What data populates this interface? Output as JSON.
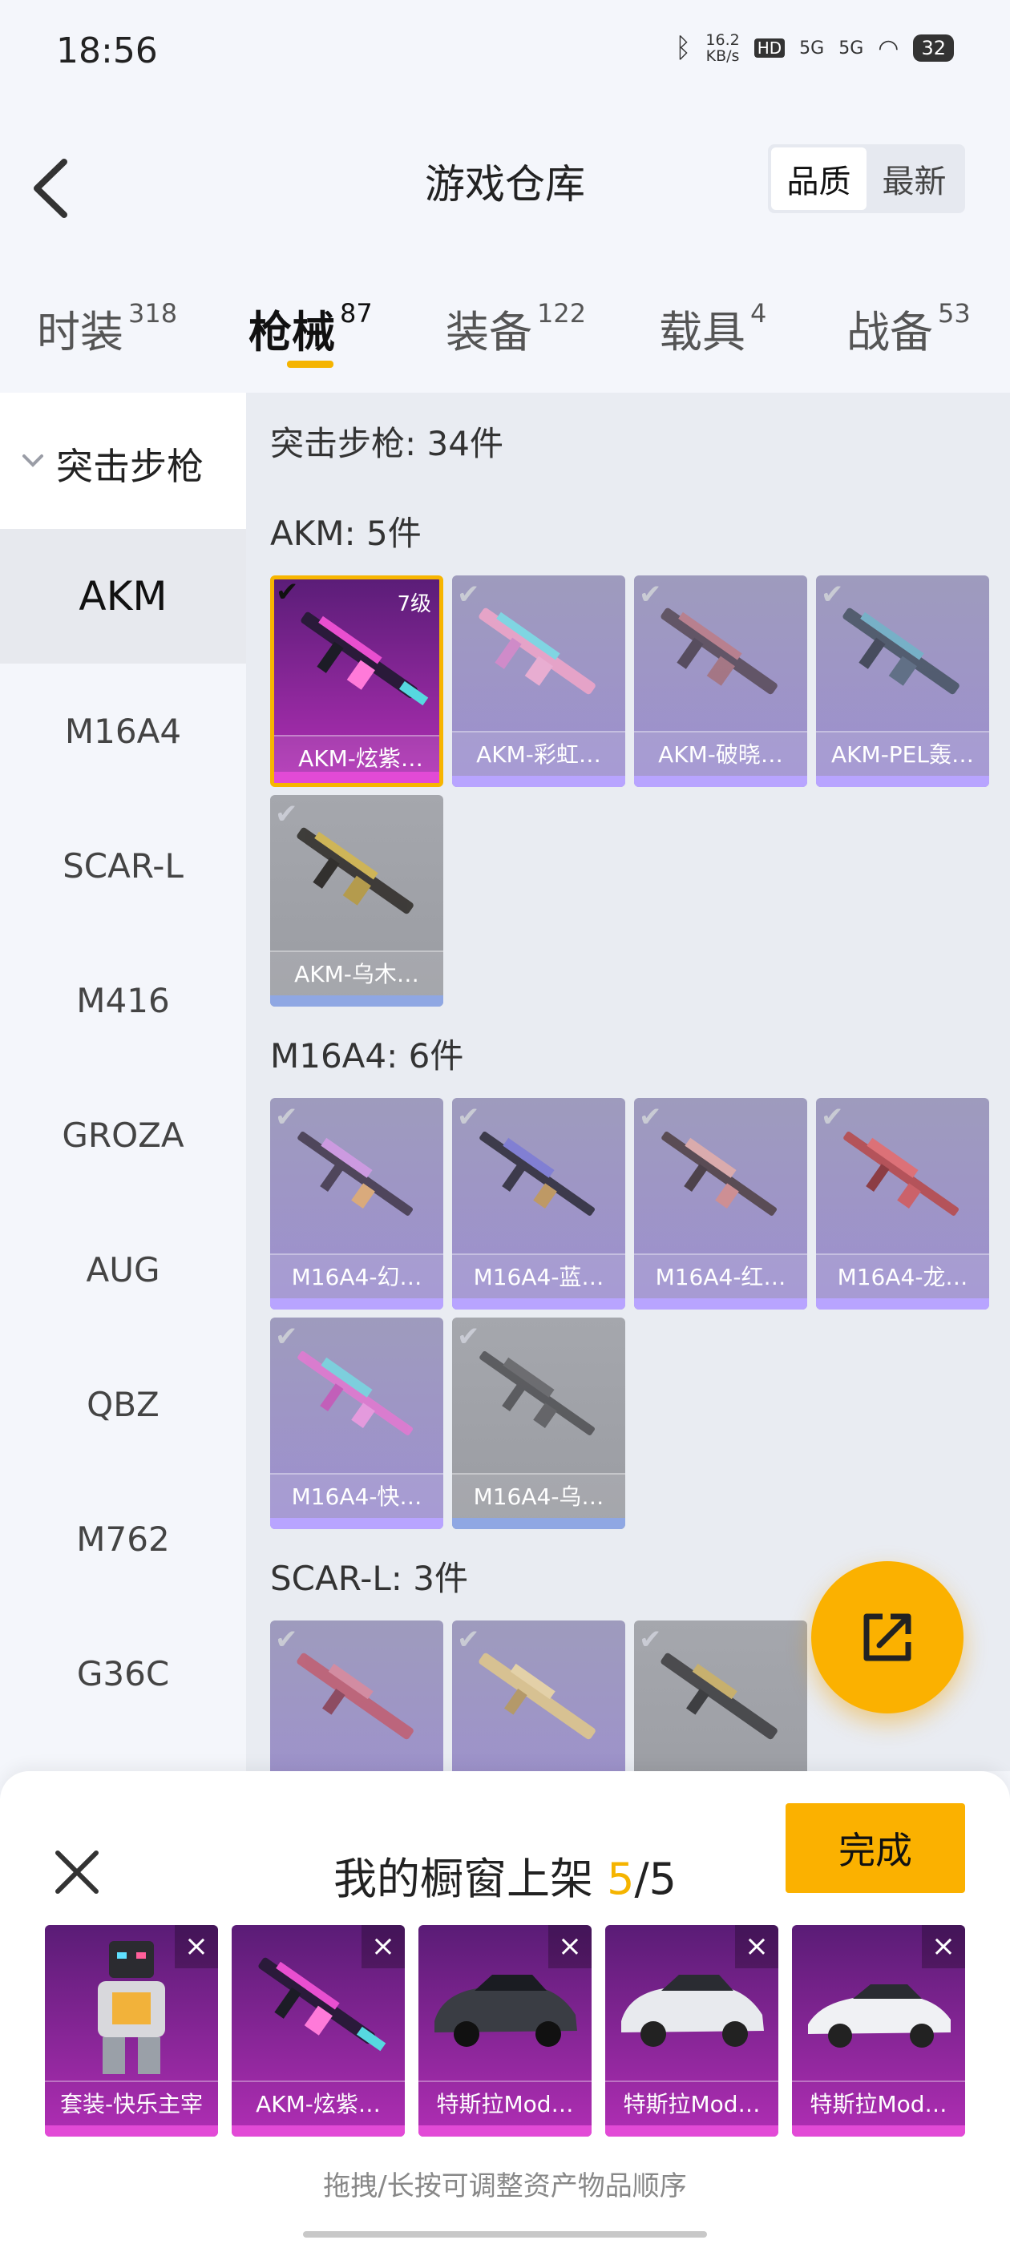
{
  "status": {
    "time": "18:56",
    "speed_top": "16.2",
    "speed_bottom": "KB/s",
    "hd": "HD",
    "sig1": "5G",
    "sig2": "5G",
    "battery": "32"
  },
  "header": {
    "title": "游戏仓库",
    "sort_quality": "品质",
    "sort_newest": "最新"
  },
  "tabs": [
    {
      "label": "时装",
      "count": "318"
    },
    {
      "label": "枪械",
      "count": "87"
    },
    {
      "label": "装备",
      "count": "122"
    },
    {
      "label": "载具",
      "count": "4"
    },
    {
      "label": "战备",
      "count": "53"
    }
  ],
  "nav": {
    "header": "突击步枪",
    "items": [
      "AKM",
      "M16A4",
      "SCAR-L",
      "M416",
      "GROZA",
      "AUG",
      "QBZ",
      "M762",
      "G36C"
    ],
    "selected": "AKM"
  },
  "main": {
    "section_total": "突击步枪: 34件",
    "groups": [
      {
        "title": "AKM: 5件",
        "items": [
          "AKM-炫紫…",
          "AKM-彩虹…",
          "AKM-破晓…",
          "AKM-PEL轰…",
          "AKM-乌木…"
        ],
        "selected_level": "7级"
      },
      {
        "title": "M16A4: 6件",
        "items": [
          "M16A4-幻…",
          "M16A4-蓝…",
          "M16A4-红…",
          "M16A4-龙…",
          "M16A4-快…",
          "M16A4-乌…"
        ]
      },
      {
        "title": "SCAR-L: 3件",
        "items": [
          "",
          "",
          ""
        ]
      }
    ]
  },
  "panel": {
    "title_prefix": "我的橱窗上架",
    "count": "5",
    "total": "/5",
    "done": "完成",
    "items": [
      "套装-快乐主宰",
      "AKM-炫紫…",
      "特斯拉Mod…",
      "特斯拉Mod…",
      "特斯拉Mod…"
    ],
    "remove_glyph": "×",
    "hint": "拖拽/长按可调整资产物品顺序"
  },
  "colors": {
    "accent": "#fbb100",
    "selected_border": "#f7b500",
    "rarity_purple": "#b02eb4"
  }
}
